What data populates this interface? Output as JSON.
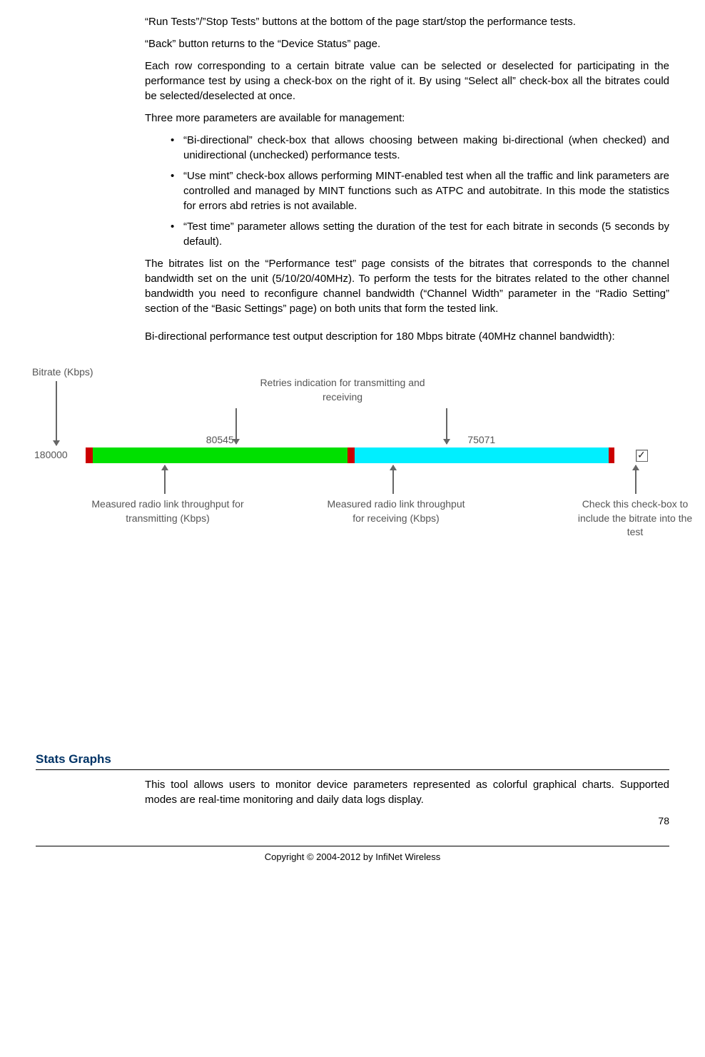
{
  "para1": "“Run Tests”/”Stop Tests” buttons at the bottom of the page start/stop the performance tests.",
  "para2": "“Back” button returns to the “Device Status” page.",
  "para3": "Each row corresponding to a certain bitrate value can be selected or deselected for participating in the performance test by using a check-box on the right of it. By using “Select all” check-box all the bitrates could be selected/deselected at once.",
  "para4": "Three more parameters are available for management:",
  "bullet1": "“Bi-directional” check-box that allows choosing between making bi-directional (when checked) and unidirectional (unchecked) performance tests.",
  "bullet2": "“Use mint” check-box allows performing MINT-enabled test when all the traffic and link parameters are controlled and managed by MINT functions such as ATPC and autobitrate. In this mode the statistics for errors abd retries is not available.",
  "bullet3": "“Test time” parameter allows setting the duration of the test for each bitrate in seconds (5 seconds by default).",
  "para5": "The bitrates list on the “Performance test” page consists of the bitrates that corresponds to the channel bandwidth set on the unit (5/10/20/40MHz). To perform the tests for the bitrates related to the other channel bandwidth you need to reconfigure channel bandwidth (“Channel Width” parameter in the “Radio Setting” section of the “Basic Settings” page) on both units that form the tested link.",
  "para6": "Bi-directional performance test output description for 180 Mbps bitrate (40MHz channel bandwidth):",
  "diagram": {
    "bitrate_label": "Bitrate (Kbps)",
    "bitrate_value": "180000",
    "retries_label": "Retries indication for transmitting and receiving",
    "tx_value": "80545",
    "rx_value": "75071",
    "tx_caption": "Measured radio link throughput for transmitting (Kbps)",
    "rx_caption": "Measured radio link throughput for receiving (Kbps)",
    "chk_caption": "Check this check-box to include the bitrate into the test"
  },
  "heading": "Stats Graphs",
  "para7": "This tool allows users to monitor device parameters represented as colorful graphical charts. Supported modes are real-time monitoring and daily data logs display.",
  "page_number": "78",
  "copyright": "Copyright © 2004-2012 by InfiNet Wireless",
  "chart_data": {
    "type": "bar",
    "title": "Bi-directional performance test output (180 Mbps, 40MHz)",
    "categories": [
      "Transmitting throughput",
      "Receiving throughput"
    ],
    "values": [
      80545,
      75071
    ],
    "ylabel": "Kbps",
    "bitrate_kbps": 180000
  }
}
